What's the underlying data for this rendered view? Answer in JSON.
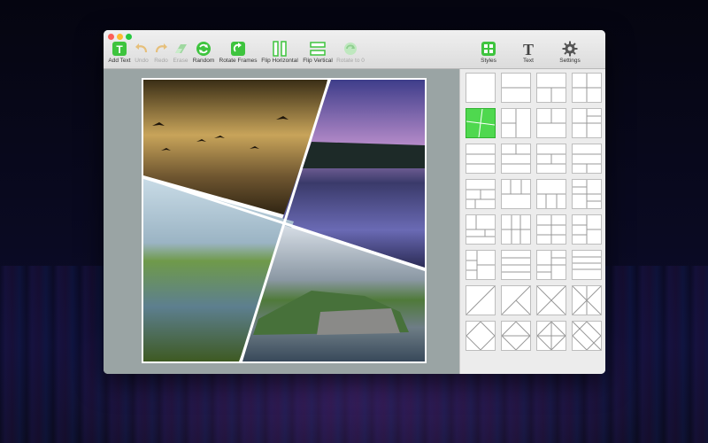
{
  "toolbar": {
    "add_text": "Add Text",
    "undo": "Undo",
    "redo": "Redo",
    "erase": "Erase",
    "random": "Random",
    "rotate_frames": "Rotate Frames",
    "flip_horizontal": "Flip Horizontal",
    "flip_vertical": "Flip Vertical",
    "rotate_to_0": "Rotate to 0",
    "styles": "Styles",
    "text": "Text",
    "settings": "Settings"
  },
  "colors": {
    "accent_green": "#4fd84f",
    "canvas_background": "#9aa4a4"
  },
  "styles_panel": {
    "selected_index": 4,
    "layout_count": 32
  }
}
